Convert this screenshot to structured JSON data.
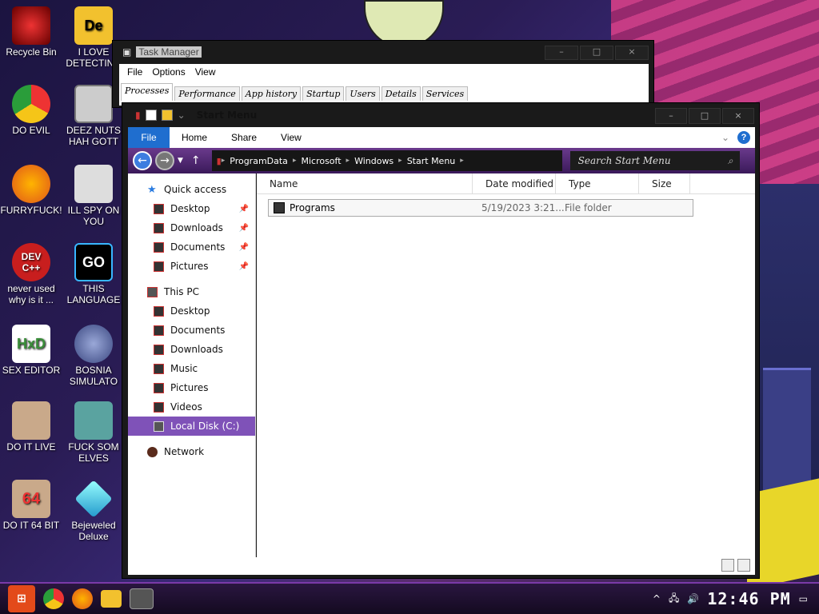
{
  "desktop": {
    "icons": [
      {
        "label": "Recycle Bin",
        "icon": "recycle-bin-icon"
      },
      {
        "label": "I LOVE DETECTING",
        "icon": "detective-icon"
      },
      {
        "label": "DO EVIL",
        "icon": "chrome-icon"
      },
      {
        "label": "DEEZ NUTS HAH GOTT",
        "icon": "copy-windows-icon"
      },
      {
        "label": "FURRYFUCK!",
        "icon": "firefox-icon"
      },
      {
        "label": "ILL SPY ON YOU",
        "icon": "spyglass-icon"
      },
      {
        "label": "never used why is it ...",
        "icon": "devcpp-icon",
        "badge": "DEV C++"
      },
      {
        "label": "THIS LANGUAGE",
        "icon": "goland-icon",
        "badge": "GO"
      },
      {
        "label": "SEX EDITOR",
        "icon": "hxd-icon",
        "badge": "HxD"
      },
      {
        "label": "BOSNIA SIMULATO",
        "icon": "mine-icon"
      },
      {
        "label": "DO IT LIVE",
        "icon": "portrait-icon"
      },
      {
        "label": "FUCK SOM ELVES",
        "icon": "santa-icon"
      },
      {
        "label": "DO IT 64 BIT",
        "icon": "portrait-64-icon",
        "badge": "64"
      },
      {
        "label": "Bejeweled Deluxe",
        "icon": "diamond-icon"
      }
    ]
  },
  "task_manager": {
    "title": "Task Manager",
    "menu": [
      "File",
      "Options",
      "View"
    ],
    "tabs": [
      "Processes",
      "Performance",
      "App history",
      "Startup",
      "Users",
      "Details",
      "Services"
    ]
  },
  "explorer": {
    "title": "Start Menu",
    "ribbon": {
      "file": "File",
      "tabs": [
        "Home",
        "Share",
        "View"
      ]
    },
    "address": [
      "ProgramData",
      "Microsoft",
      "Windows",
      "Start Menu"
    ],
    "search_placeholder": "Search Start Menu",
    "nav": {
      "quick_access": "Quick access",
      "quick_items": [
        "Desktop",
        "Downloads",
        "Documents",
        "Pictures"
      ],
      "this_pc": "This PC",
      "pc_items": [
        "Desktop",
        "Documents",
        "Downloads",
        "Music",
        "Pictures",
        "Videos",
        "Local Disk (C:)"
      ],
      "network": "Network"
    },
    "columns": [
      "Name",
      "Date modified",
      "Type",
      "Size"
    ],
    "rows": [
      {
        "name": "Programs",
        "date": "5/19/2023 3:21...",
        "type": "File folder",
        "size": ""
      }
    ]
  },
  "taskbar": {
    "clock": "12:46 PM"
  }
}
